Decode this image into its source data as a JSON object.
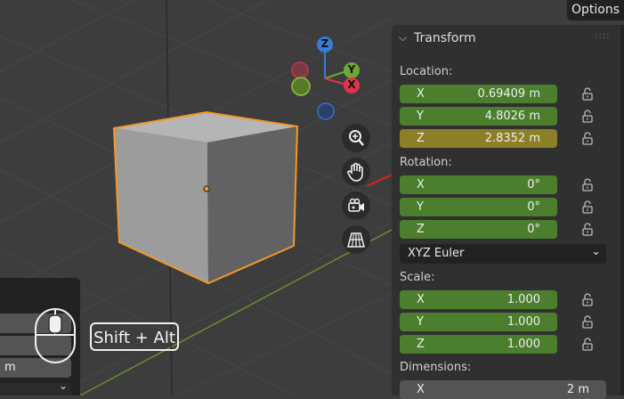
{
  "header": {
    "options_label": "Options"
  },
  "transform": {
    "title": "Transform",
    "location_label": "Location:",
    "location": [
      {
        "axis": "X",
        "value": "0.69409 m"
      },
      {
        "axis": "Y",
        "value": "4.8026 m"
      },
      {
        "axis": "Z",
        "value": "2.8352 m"
      }
    ],
    "rotation_label": "Rotation:",
    "rotation": [
      {
        "axis": "X",
        "value": "0°"
      },
      {
        "axis": "Y",
        "value": "0°"
      },
      {
        "axis": "Z",
        "value": "0°"
      }
    ],
    "rotation_mode": "XYZ Euler",
    "scale_label": "Scale:",
    "scale": [
      {
        "axis": "X",
        "value": "1.000"
      },
      {
        "axis": "Y",
        "value": "1.000"
      },
      {
        "axis": "Z",
        "value": "1.000"
      }
    ],
    "dimensions_label": "Dimensions:",
    "dimensions": [
      {
        "axis": "X",
        "value": "2 m"
      }
    ]
  },
  "gizmo": {
    "z": "Z",
    "y": "Y",
    "x": "X"
  },
  "left_panel": {
    "unit": "m"
  },
  "hint": {
    "keys": "Shift + Alt"
  },
  "colors": {
    "field_green": "#4b7f2e",
    "field_highlight": "#8c7f28",
    "selection_outline": "#f5962a",
    "annotation_arrow": "#e02020"
  }
}
